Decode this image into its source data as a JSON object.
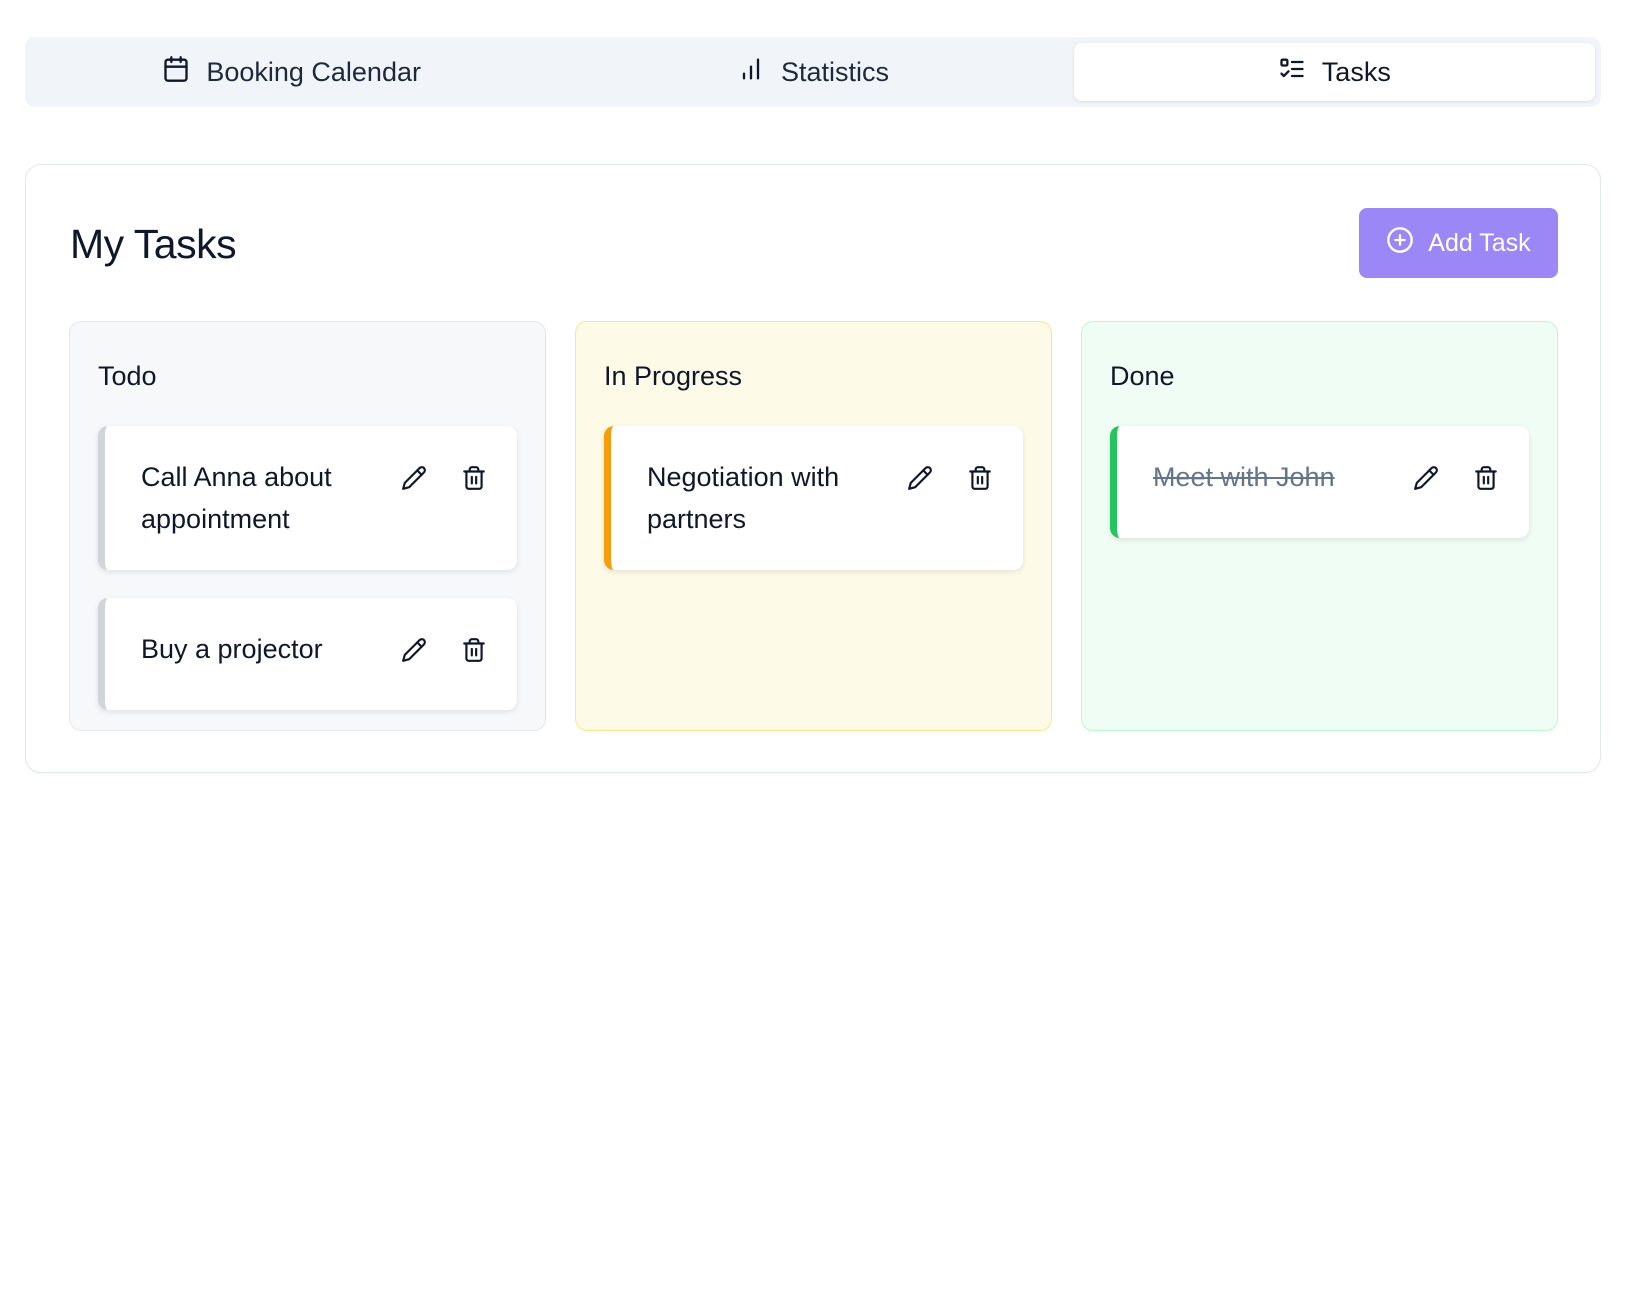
{
  "tabs": [
    {
      "label": "Booking Calendar",
      "icon": "calendar-icon",
      "active": false
    },
    {
      "label": "Statistics",
      "icon": "bar-chart-icon",
      "active": false
    },
    {
      "label": "Tasks",
      "icon": "list-check-icon",
      "active": true
    }
  ],
  "panel": {
    "title": "My Tasks",
    "add_button_label": "Add Task"
  },
  "columns": [
    {
      "title": "Todo",
      "accent": "#d1d5db",
      "cards": [
        {
          "text": "Call Anna about appointment"
        },
        {
          "text": "Buy a projector"
        }
      ]
    },
    {
      "title": "In Progress",
      "accent": "#f59e0b",
      "cards": [
        {
          "text": "Negotiation with partners"
        }
      ]
    },
    {
      "title": "Done",
      "accent": "#22c55e",
      "cards": [
        {
          "text": "Meet with John"
        }
      ]
    }
  ],
  "colors": {
    "primary_button": "#9b87f5",
    "tab_bar_bg": "#f1f5f9"
  }
}
